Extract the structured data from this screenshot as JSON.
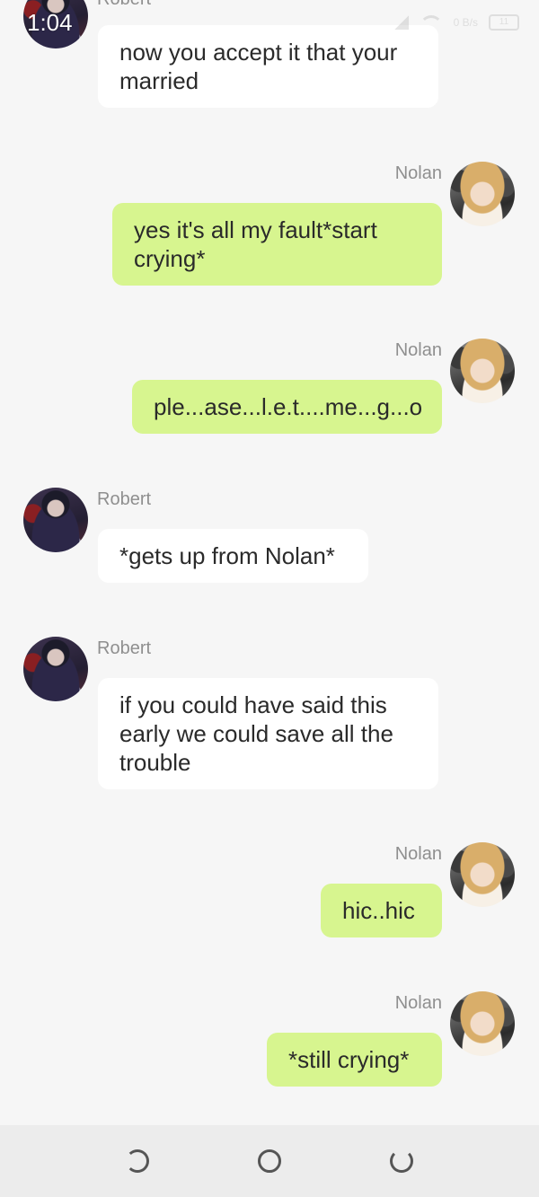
{
  "status_bar": {
    "time": "1:04",
    "network_speed": "0 B/s",
    "battery": "11"
  },
  "messages": [
    {
      "sender": "Robert",
      "side": "left",
      "text": "now you accept it that your married",
      "show_name": false
    },
    {
      "sender": "Nolan",
      "side": "right",
      "text": "yes it's all my fault*start crying*"
    },
    {
      "sender": "Nolan",
      "side": "right",
      "text": "ple...ase...l.e.t....me...g...o"
    },
    {
      "sender": "Robert",
      "side": "left",
      "text": "*gets up from Nolan*"
    },
    {
      "sender": "Robert",
      "side": "left",
      "text": "if you could have said this early we could save all the trouble"
    },
    {
      "sender": "Nolan",
      "side": "right",
      "text": "hic..hic"
    },
    {
      "sender": "Nolan",
      "side": "right",
      "text": "*still crying*"
    }
  ],
  "top_partial_name": "Robert",
  "colors": {
    "background": "#f6f6f6",
    "incoming_bubble": "#ffffff",
    "outgoing_bubble": "#d7f58f",
    "name_text": "#8f8f8f",
    "nav_bar": "#ececec"
  },
  "nav_bar": {
    "back_icon": "back-icon",
    "home_icon": "home-icon",
    "recent_icon": "recent-apps-icon"
  }
}
